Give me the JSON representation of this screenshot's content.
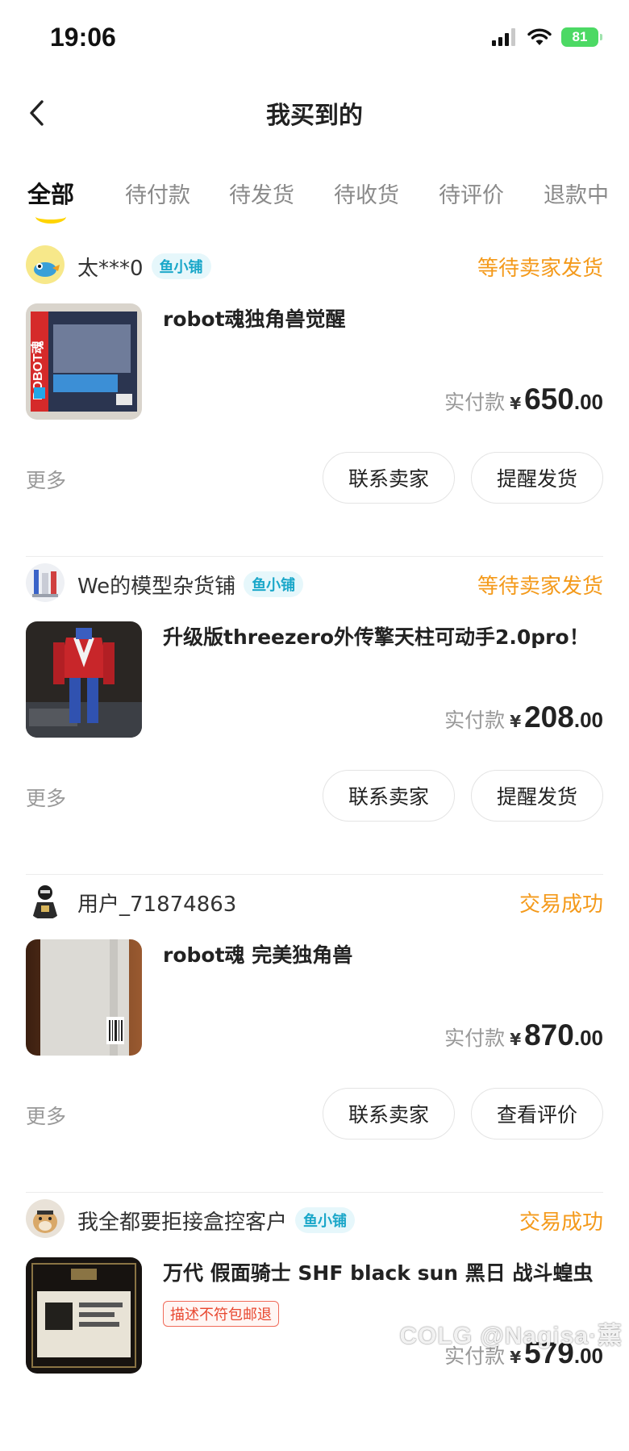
{
  "status_bar": {
    "time": "19:06",
    "battery": "81"
  },
  "nav": {
    "title": "我买到的"
  },
  "tabs": [
    {
      "label": "全部",
      "active": true
    },
    {
      "label": "待付款"
    },
    {
      "label": "待发货"
    },
    {
      "label": "待收货"
    },
    {
      "label": "待评价"
    },
    {
      "label": "退款中"
    }
  ],
  "orders": [
    {
      "seller": "太***0",
      "shop_badge": "鱼小铺",
      "status": "等待卖家发货",
      "title": "robot魂独角兽觉醒",
      "price_label": "实付款",
      "currency": "¥",
      "price_int": "650",
      "price_dec": ".00",
      "more": "更多",
      "btn_contact": "联系卖家",
      "btn_primary": "提醒发货"
    },
    {
      "seller": "We的模型杂货铺",
      "shop_badge": "鱼小铺",
      "status": "等待卖家发货",
      "title": "升级版threezero外传擎天柱可动手2.0pro！",
      "price_label": "实付款",
      "currency": "¥",
      "price_int": "208",
      "price_dec": ".00",
      "more": "更多",
      "btn_contact": "联系卖家",
      "btn_primary": "提醒发货"
    },
    {
      "seller": "用户_71874863",
      "status": "交易成功",
      "title": "robot魂 完美独角兽",
      "price_label": "实付款",
      "currency": "¥",
      "price_int": "870",
      "price_dec": ".00",
      "more": "更多",
      "btn_contact": "联系卖家",
      "btn_primary": "查看评价"
    },
    {
      "seller": "我全都要拒接盒控客户",
      "shop_badge": "鱼小铺",
      "status": "交易成功",
      "title": "万代 假面骑士 SHF black sun 黑日 战斗蝗虫",
      "tag": "描述不符包邮退",
      "price_label": "实付款",
      "currency": "¥",
      "price_int": "579",
      "price_dec": ".00"
    }
  ],
  "watermark": "COLG @Nagisa·薰",
  "colors": {
    "accent_yellow": "#ffd400",
    "status_orange": "#f49a1b",
    "badge_cyan": "#1aa7c9",
    "tag_red": "#e8472f",
    "battery_green": "#4cd964"
  },
  "icons": [
    "back-chevron-icon",
    "signal-icon",
    "wifi-icon",
    "battery-icon"
  ]
}
